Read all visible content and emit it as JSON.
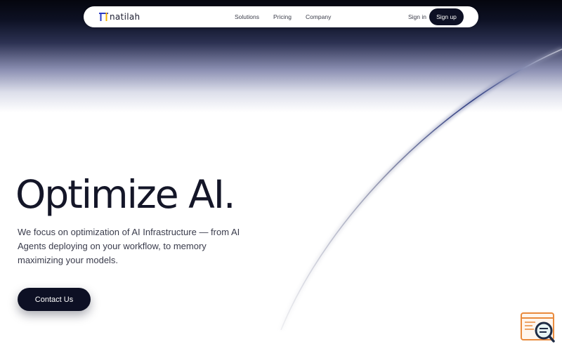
{
  "brand": {
    "name": "natilah",
    "logo_icon": "pi-logo-icon",
    "colors": {
      "dark": "#0d1024",
      "logo_accent_left": "#2b3cc4",
      "logo_accent_right": "#f5b400",
      "widget_accent": "#e98a3c"
    }
  },
  "nav": {
    "links": [
      {
        "label": "Solutions"
      },
      {
        "label": "Pricing"
      },
      {
        "label": "Company"
      }
    ],
    "signin_label": "Sign in",
    "signup_label": "Sign up"
  },
  "hero": {
    "title": "Optimize AI.",
    "description": "We focus on optimization of AI Infrastructure — from AI Agents deploying on your workflow, to memory maximizing your models.",
    "cta_label": "Contact Us"
  },
  "widget": {
    "icon": "search-document-icon"
  }
}
